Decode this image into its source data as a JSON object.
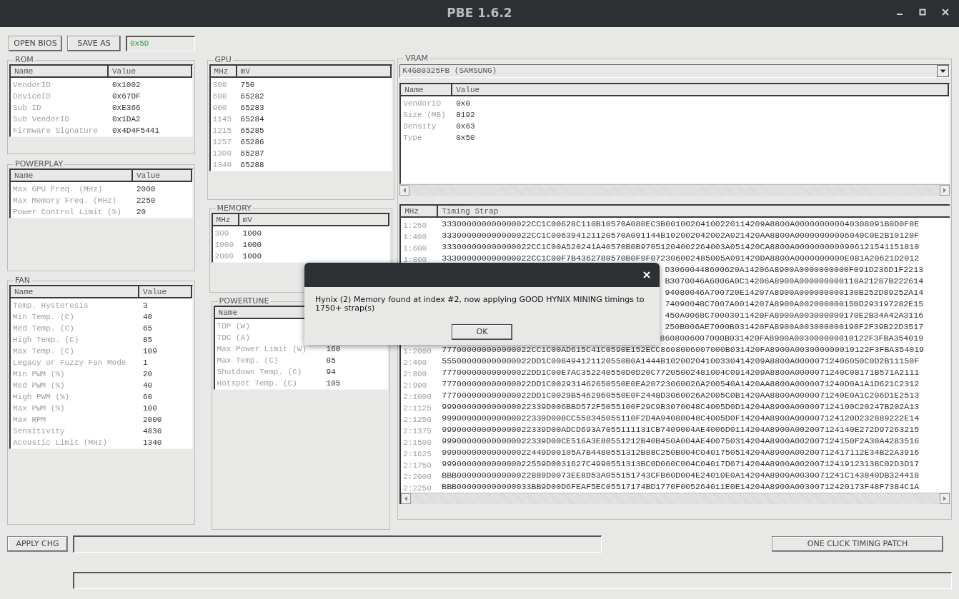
{
  "window": {
    "title": "PBE 1.6.2"
  },
  "toolbar": {
    "buttons": [
      "OPEN BIOS",
      "SAVE AS"
    ],
    "field_value": "0x5D"
  },
  "rom": {
    "title": "ROM",
    "columns": [
      "Name",
      "Value"
    ],
    "rows": [
      [
        "VendorID",
        "0x1002"
      ],
      [
        "DeviceID",
        "0x67DF"
      ],
      [
        "Sub ID",
        "0xE366"
      ],
      [
        "Sub VendorID",
        "0x1DA2"
      ],
      [
        "Firmware Signature",
        "0x4D4F5441"
      ]
    ]
  },
  "powerplay": {
    "title": "POWERPLAY",
    "columns": [
      "Name",
      "Value"
    ],
    "rows": [
      [
        "Max GPU Freq. (MHz)",
        "2000"
      ],
      [
        "Max Memory Freq. (MHz)",
        "2250"
      ],
      [
        "Power Control Limit (%)",
        "20"
      ]
    ]
  },
  "fan": {
    "title": "FAN",
    "columns": [
      "Name",
      "Value"
    ],
    "rows": [
      [
        "Temp. Hysteresis",
        "3"
      ],
      [
        "Min Temp. (C)",
        "40"
      ],
      [
        "Med Temp. (C)",
        "65"
      ],
      [
        "High Temp. (C)",
        "85"
      ],
      [
        "Max Temp. (C)",
        "109"
      ],
      [
        "Legacy or Fuzzy Fan Mode",
        "1"
      ],
      [
        "Min PWM (%)",
        "20"
      ],
      [
        "Med PWM (%)",
        "40"
      ],
      [
        "High PWM (%)",
        "60"
      ],
      [
        "Max PWM (%)",
        "100"
      ],
      [
        "Max RPM",
        "2000"
      ],
      [
        "Sensitivity",
        "4836"
      ],
      [
        "Acoustic Limit (MHz)",
        "1340"
      ]
    ]
  },
  "gpu": {
    "title": "GPU",
    "columns": [
      "MHz",
      "mV"
    ],
    "rows": [
      [
        "300",
        "750"
      ],
      [
        "600",
        "65282"
      ],
      [
        "900",
        "65283"
      ],
      [
        "1145",
        "65284"
      ],
      [
        "1215",
        "65285"
      ],
      [
        "1257",
        "65286"
      ],
      [
        "1300",
        "65287"
      ],
      [
        "1340",
        "65288"
      ]
    ]
  },
  "memory": {
    "title": "MEMORY",
    "columns": [
      "MHz",
      "mV"
    ],
    "rows": [
      [
        "300",
        "1000"
      ],
      [
        "1000",
        "1000"
      ],
      [
        "2000",
        "1000"
      ]
    ]
  },
  "powertune": {
    "title": "POWERTUNE",
    "columns": [
      "Name"
    ],
    "rows": [
      [
        "TDP (W)"
      ],
      [
        "TDC (A)"
      ],
      [
        "Max Power Limit (W)",
        "160"
      ],
      [
        "Max Temp. (C)",
        "85"
      ],
      [
        "Shutdown Temp. (C)",
        "94"
      ],
      [
        "Hotspot Temp. (C)",
        "105"
      ]
    ]
  },
  "vram": {
    "title": "VRAM",
    "dropdown": "K4G80325FB (SAMSUNG)",
    "info": {
      "columns": [
        "Name",
        "Value"
      ],
      "rows": [
        [
          "VendorID",
          "0x0"
        ],
        [
          "Size (MB)",
          "8192"
        ],
        [
          "Density",
          "0x63"
        ],
        [
          "Type",
          "0x50"
        ]
      ]
    },
    "timing": {
      "columns": [
        "MHz",
        "Timing Strap"
      ],
      "rows": [
        {
          "mhz": "1:250",
          "strap": "333000000000000022CC1C00628C110B10570A080EC3B00100204100220114209A8800A000000000040308091B0D0F0E"
        },
        {
          "mhz": "1:400",
          "strap": "333000000000000022CC1C006394121120570A091144B102002042002A021420AA8800A00000000006040C0E2B10120F"
        },
        {
          "mhz": "1:600",
          "strap": "333000000000000022CC1C00A520241A40570B0B97051204002264003A051420CA8800A0000000000906121541151810"
        },
        {
          "mhz": "1:800",
          "strap": "333000000000000022CC1C00F7B4362780570B0F9F072306002485005A091420DA8800A0000000000E081A20621D2012"
        },
        {
          "strap": "D30600448600620A14206A8900A0000000000F091D236D1F2213"
        },
        {
          "strap": "B3070046A6006A0C14206A8900A000000000110A21287B222614"
        },
        {
          "strap": "94080046A700720E14207A8900A000000000130B252D89252A14"
        },
        {
          "strap": "74090048C7007A0014207A8900A002000000150D293197282E15"
        },
        {
          "strap": "450A0068C70003011420FA8900A003000000170E2B34A42A3116"
        },
        {
          "strap": "250B006AE7000B031420FA8900A003000000190F2F39B22D3517"
        },
        {
          "strap": "8608006007000B031420FA8900A003000000010122F3FBA354019"
        },
        {
          "mhz": "1:2000",
          "strap": "777000000000000022CC1C00AD615C41C0590E152ECC8608006007000B031420FA8900A003000000010122F3FBA354019"
        },
        {
          "mhz": "2:400",
          "strap": "555000000000000022DD1C008494121120550B0A1444B10200204100330414209A8800A00000712406050C0D2B11150F"
        },
        {
          "mhz": "2:800",
          "strap": "777000000000000022DD1C00E7AC352240550D0D20C77205002481004C0914209A8800A0000071240C08171B571A2111"
        },
        {
          "mhz": "2:900",
          "strap": "777000000000000022DD1C002931462650550E0EA20723060026A200540A1420AA8800A0000071240D0A1A1D621C2312"
        },
        {
          "mhz": "2:1000",
          "strap": "777000000000000022DD1C0029B5462960550E0F2448D3060026A2005C0B1420AA8800A0000071240E0A1C206D1E2513"
        },
        {
          "mhz": "2:1125",
          "strap": "999000000000000022339D006BBD572F5055100F29C9B3070048C4005D0D14204A8900A000007124100C20247B202A13"
        },
        {
          "mhz": "2:1250",
          "strap": "999000000000000022339D008CC558345055110F2D4A94080048C4005D0F14204A8900A000007124120D232889222E14"
        },
        {
          "mhz": "2:1375",
          "strap": "999000000000000022339D00ADCD693A7055111131CB7409004AE4006D0114204A8900A002007124140E272D97263215"
        },
        {
          "mhz": "2:1500",
          "strap": "999000000000000022339D00CE516A3E80551212B40B450A004AE400750314204A8900A002007124150F2A30A4283516"
        },
        {
          "mhz": "2:1625",
          "strap": "999000000000000022449D00105A7B4480551312B88C250B004C0401750514204A8900A00200712417112E34B22A3916"
        },
        {
          "mhz": "2:1750",
          "strap": "999000000000000022559D0031627C4990551313BC0D060C004C04017D0714204A8900A00200712419123138C02D3D17"
        },
        {
          "mhz": "2:2000",
          "strap": "BBB000000000000022889D0073EE8D53A055151743CFB60D004E24010E0A14204A8900A0030071241C143840DB324418"
        },
        {
          "mhz": "2:2250",
          "strap": "BBB000000000000033BB9D00D6FEAF5EC05517174BD1770F005264011E0E14204A8900A00300712420173F48F7384C1A"
        }
      ]
    }
  },
  "bottom": {
    "apply_button": "APPLY CHG",
    "patch_button": "ONE CLICK TIMING PATCH"
  },
  "dialog": {
    "message": "Hynix (2) Memory found at index #2, now applying GOOD HYNIX MINING timings to 1750+ strap(s)",
    "button": "OK"
  }
}
